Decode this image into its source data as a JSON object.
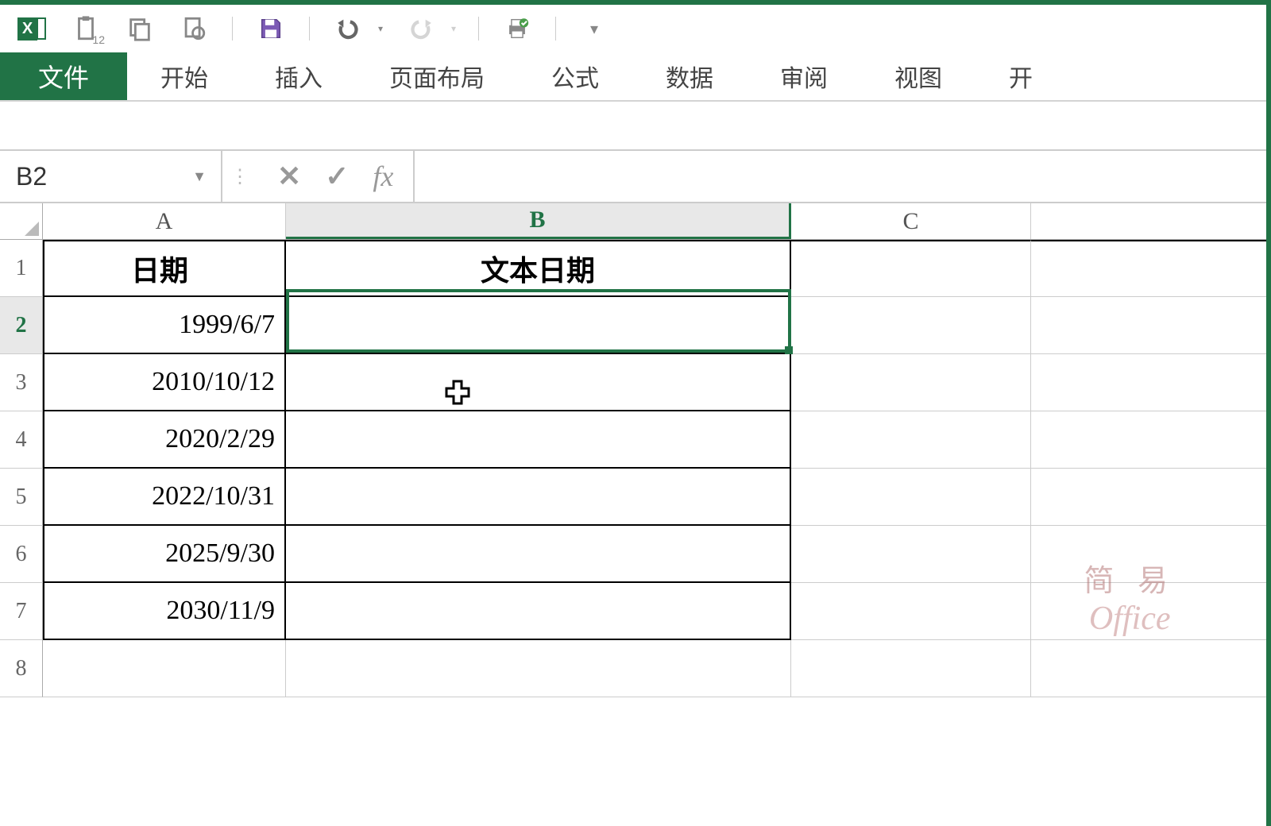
{
  "qat": {
    "paste_badge": "12"
  },
  "ribbon": {
    "tabs": [
      "文件",
      "开始",
      "插入",
      "页面布局",
      "公式",
      "数据",
      "审阅",
      "视图",
      "开"
    ]
  },
  "formula_bar": {
    "name_box": "B2",
    "cancel": "✕",
    "confirm": "✓",
    "fx_label": "fx",
    "value": ""
  },
  "columns": [
    "A",
    "B",
    "C"
  ],
  "row_headers": [
    "1",
    "2",
    "3",
    "4",
    "5",
    "6",
    "7",
    "8"
  ],
  "table": {
    "headerA": "日期",
    "headerB": "文本日期",
    "rows": [
      {
        "A": "1999/6/7",
        "B": ""
      },
      {
        "A": "2010/10/12",
        "B": ""
      },
      {
        "A": "2020/2/29",
        "B": ""
      },
      {
        "A": "2022/10/31",
        "B": ""
      },
      {
        "A": "2025/9/30",
        "B": ""
      },
      {
        "A": "2030/11/9",
        "B": ""
      }
    ]
  },
  "watermark": {
    "line1": "简 易",
    "line2": "Office"
  },
  "colors": {
    "accent": "#217346"
  }
}
